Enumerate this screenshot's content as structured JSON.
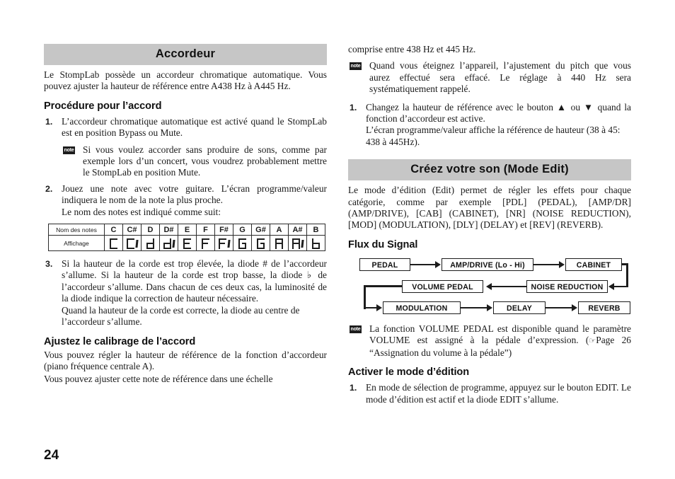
{
  "page": {
    "number": "24"
  },
  "left_column": {
    "banner_title": "Accordeur",
    "intro": "Le StompLab possède un accordeur chromatique automatique. Vous pouvez ajuster la hauteur de référence entre A438 Hz à A445 Hz.",
    "heading_procedure": "Procédure pour l’accord",
    "step1": {
      "number": "1.",
      "text": "L’accordeur chromatique automatique est activé quand le StompLab est en position Bypass ou Mute."
    },
    "note1": {
      "badge": "note",
      "text": "Si vous voulez accorder sans produire de sons, comme par exemple lors d’un concert, vous voudrez probablement mettre le StompLab en position Mute."
    },
    "step2": {
      "number": "2.",
      "text": "Jouez une note avec votre guitare. L’écran programme/valeur indiquera le nom de la note la plus proche.",
      "line2": "Le nom des notes est indiqué comme suit:"
    },
    "note_table": {
      "row_headers": [
        "Nom des notes",
        "Affichage"
      ],
      "note_names": [
        "C",
        "C#",
        "D",
        "D#",
        "E",
        "F",
        "F#",
        "G",
        "G#",
        "A",
        "A#",
        "B"
      ],
      "display_glyphs": [
        "C",
        "C'",
        "d",
        "d'",
        "E",
        "F",
        "F'",
        "G",
        "G'",
        "A",
        "A'",
        "b"
      ]
    },
    "step3": {
      "number": "3.",
      "text": "Si la hauteur de la corde est trop élevée, la diode # de l’accordeur s’allume. Si la hauteur de la corde est trop basse, la diode ♭ de l’accordeur s’allume. Dans chacun de ces deux cas, la luminosité de la diode indique la correction de hauteur nécessaire.",
      "line2": "Quand la hauteur de la corde est correcte, la diode au centre de l’accordeur s’allume."
    },
    "heading_calibration": "Ajustez le calibrage de l’accord",
    "calibration_text": "Vous pouvez régler la hauteur de référence de la fonction d’accordeur (piano fréquence centrale A).",
    "calibration_text2": "Vous pouvez ajuster cette note de référence dans une échelle"
  },
  "right_column": {
    "continuation": "comprise entre 438 Hz et 445 Hz.",
    "note2": {
      "badge": "note",
      "text": "Quand vous éteignez l’appareil, l’ajustement du pitch que vous aurez effectué sera effacé. Le réglage à 440 Hz sera systématiquement rappelé."
    },
    "step1": {
      "number": "1.",
      "text": "Changez la hauteur de référence avec le bouton ▲ ou ▼  quand la fonction d’accordeur est active.",
      "line2": "L’écran programme/valeur affiche la référence de hauteur (38 à 45: 438 à 445Hz)."
    },
    "banner_title": "Créez votre son (Mode Edit)",
    "edit_intro": "Le mode d’édition (Edit) permet de régler les effets pour chaque catégorie, comme par exemple [PDL] (PEDAL), [AMP/DR] (AMP/DRIVE), [CAB] (CABINET), [NR] (NOISE REDUCTION), [MOD] (MODULATION), [DLY] (DELAY) et [REV] (REVERB).",
    "heading_flow": "Flux du Signal",
    "flow_diagram": {
      "boxes": [
        "PEDAL",
        "AMP/DRIVE (Lo - Hi)",
        "CABINET",
        "VOLUME PEDAL",
        "NOISE REDUCTION",
        "MODULATION",
        "DELAY",
        "REVERB"
      ]
    },
    "note3": {
      "badge": "note",
      "text_before": "La fonction VOLUME PEDAL est disponible quand le paramètre VOLUME est assigné à la pédale d’expression. (",
      "hand_icon": "☞",
      "text_after": "Page 26 “Assignation du volume à la pédale”)"
    },
    "heading_activate": "Activer le mode d’édition",
    "activate_step1": {
      "number": "1.",
      "text": "En mode de sélection de programme, appuyez sur le bouton EDIT. Le mode d’édition est actif et la diode EDIT s’allume."
    }
  }
}
